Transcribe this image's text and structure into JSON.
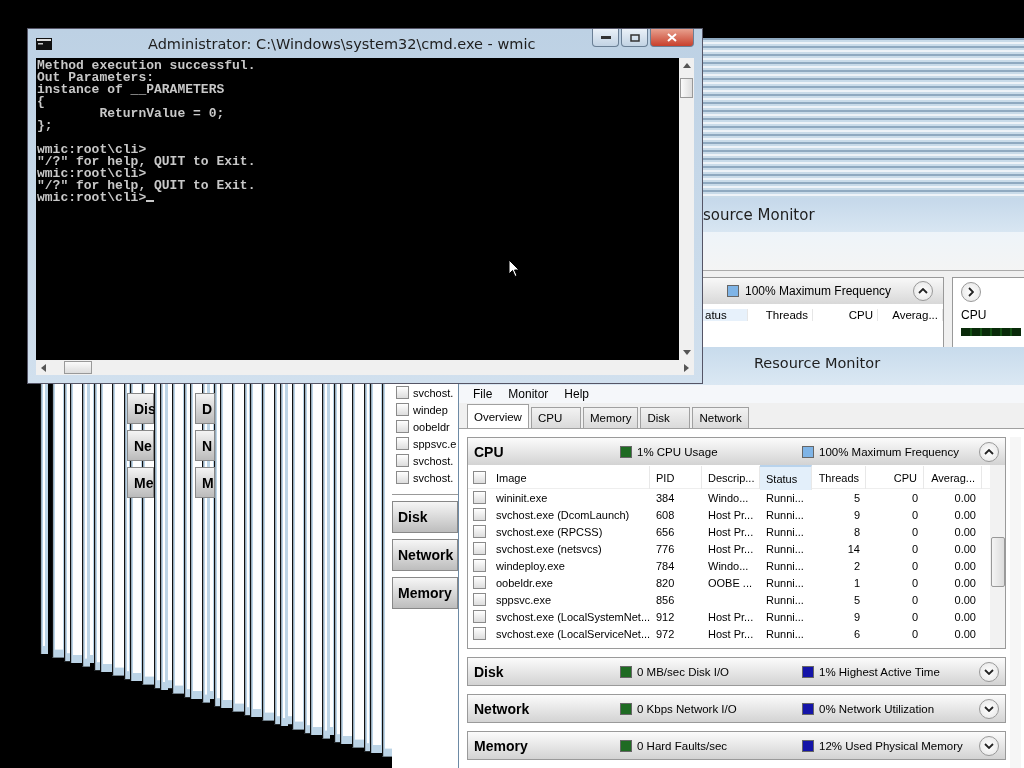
{
  "cmd_window": {
    "title": "Administrator: C:\\Windows\\system32\\cmd.exe - wmic",
    "blocks": [
      [
        "Method execution successful.",
        "Out Parameters:",
        "instance of __PARAMETERS",
        "{",
        "        ReturnValue = 0;",
        "};"
      ],
      [
        "wmic:root\\cli>",
        "\"/?\" for help, QUIT to Exit.",
        "wmic:root\\cli>",
        "\"/?\" for help, QUIT to Exit.",
        "wmic:root\\cli>"
      ]
    ],
    "cursor_visible": true
  },
  "background_monitor": {
    "title": "source Monitor",
    "stat": {
      "text": "100% Maximum Frequency",
      "color": "#7fb4e6"
    },
    "expanded": true,
    "columns": [
      "atus",
      "Threads",
      "CPU",
      "Averag..."
    ],
    "side_panel": {
      "label": "CPU"
    }
  },
  "cascade_fragments": [
    {
      "items": [
        "Dis",
        "Ne",
        "Me"
      ]
    },
    {
      "items": [
        "D",
        "N",
        "M"
      ]
    }
  ],
  "cascade_window": {
    "rows": [
      {
        "text": "svchost.",
        "checked": false
      },
      {
        "text": "windep",
        "checked": false
      },
      {
        "text": "oobeldr",
        "checked": false
      },
      {
        "text": "sppsvc.e",
        "checked": false
      },
      {
        "text": "svchost.",
        "checked": false
      },
      {
        "text": "svchost.",
        "checked": false
      }
    ],
    "sections": [
      "Disk",
      "Network",
      "Memory"
    ]
  },
  "resource_monitor": {
    "title": "Resource Monitor",
    "menu": [
      "File",
      "Monitor",
      "Help"
    ],
    "tabs": [
      {
        "label": "Overview",
        "selected": true
      },
      {
        "label": "CPU",
        "selected": false
      },
      {
        "label": "Memory",
        "selected": false
      },
      {
        "label": "Disk",
        "selected": false
      },
      {
        "label": "Network",
        "selected": false
      }
    ],
    "sections": [
      {
        "name": "CPU",
        "expanded": true,
        "stats": [
          {
            "text": "1% CPU Usage",
            "color": "#1f6b23"
          },
          {
            "text": "100% Maximum Frequency",
            "color": "#7fb4e6"
          }
        ]
      },
      {
        "name": "Disk",
        "expanded": false,
        "stats": [
          {
            "text": "0 MB/sec Disk I/O",
            "color": "#1f6b23"
          },
          {
            "text": "1% Highest Active Time",
            "color": "#1414a8"
          }
        ]
      },
      {
        "name": "Network",
        "expanded": false,
        "stats": [
          {
            "text": "0 Kbps Network I/O",
            "color": "#1f6b23"
          },
          {
            "text": "0% Network Utilization",
            "color": "#1414a8"
          }
        ]
      },
      {
        "name": "Memory",
        "expanded": false,
        "stats": [
          {
            "text": "0 Hard Faults/sec",
            "color": "#1f6b23"
          },
          {
            "text": "12% Used Physical Memory",
            "color": "#1414a8"
          }
        ]
      }
    ],
    "table": {
      "all_checked": false,
      "columns": [
        {
          "label": "Image",
          "sorted": false
        },
        {
          "label": "PID",
          "sorted": false
        },
        {
          "label": "Descrip...",
          "sorted": false
        },
        {
          "label": "Status",
          "sorted": true
        },
        {
          "label": "Threads",
          "sorted": false
        },
        {
          "label": "CPU",
          "sorted": false
        },
        {
          "label": "Averag...",
          "sorted": false
        }
      ],
      "rows": [
        {
          "checked": false,
          "cells": [
            "wininit.exe",
            "384",
            "Windo...",
            "Runni...",
            "5",
            "0",
            "0.00"
          ]
        },
        {
          "checked": false,
          "cells": [
            "svchost.exe (DcomLaunch)",
            "608",
            "Host Pr...",
            "Runni...",
            "9",
            "0",
            "0.00"
          ]
        },
        {
          "checked": false,
          "cells": [
            "svchost.exe (RPCSS)",
            "656",
            "Host Pr...",
            "Runni...",
            "8",
            "0",
            "0.00"
          ]
        },
        {
          "checked": false,
          "cells": [
            "svchost.exe (netsvcs)",
            "776",
            "Host Pr...",
            "Runni...",
            "14",
            "0",
            "0.00"
          ]
        },
        {
          "checked": false,
          "cells": [
            "windeploy.exe",
            "784",
            "Windo...",
            "Runni...",
            "2",
            "0",
            "0.00"
          ]
        },
        {
          "checked": false,
          "cells": [
            "oobeldr.exe",
            "820",
            "OOBE ...",
            "Runni...",
            "1",
            "0",
            "0.00"
          ]
        },
        {
          "checked": false,
          "cells": [
            "sppsvc.exe",
            "856",
            "",
            "Runni...",
            "5",
            "0",
            "0.00"
          ]
        },
        {
          "checked": false,
          "cells": [
            "svchost.exe (LocalSystemNet...",
            "912",
            "Host Pr...",
            "Runni...",
            "9",
            "0",
            "0.00"
          ]
        },
        {
          "checked": false,
          "cells": [
            "svchost.exe (LocalServiceNet...",
            "972",
            "Host Pr...",
            "Runni...",
            "6",
            "0",
            "0.00"
          ]
        }
      ]
    }
  }
}
